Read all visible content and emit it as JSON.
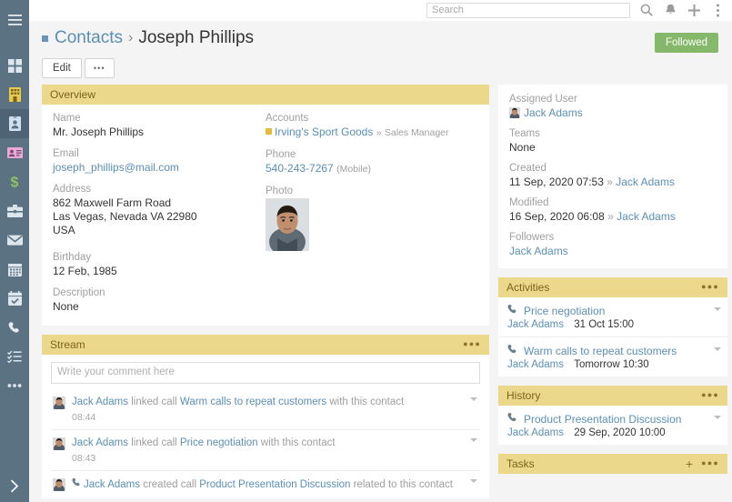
{
  "sidebar": {
    "menu_icon": "hamburger-icon",
    "collapse_icon": "chevron-right-icon",
    "items": [
      {
        "name": "dashboard",
        "icon": "grid-icon"
      },
      {
        "name": "accounts",
        "icon": "building-icon"
      },
      {
        "name": "contacts",
        "icon": "id-badge-icon",
        "active": true
      },
      {
        "name": "leads",
        "icon": "contact-card-icon"
      },
      {
        "name": "opportunities",
        "icon": "dollar-icon"
      },
      {
        "name": "cases",
        "icon": "briefcase-icon"
      },
      {
        "name": "emails",
        "icon": "envelope-icon"
      },
      {
        "name": "calendar",
        "icon": "calendar-icon"
      },
      {
        "name": "meetings",
        "icon": "calendar-check-icon"
      },
      {
        "name": "calls",
        "icon": "phone-icon"
      },
      {
        "name": "tasks",
        "icon": "list-check-icon"
      },
      {
        "name": "more",
        "icon": "ellipsis-icon"
      }
    ]
  },
  "topbar": {
    "search_placeholder": "Search",
    "search_value": "",
    "search_icon": "magnifier-icon",
    "bell_icon": "bell-icon",
    "plus_icon": "plus-icon",
    "menu_icon": "vertical-ellipsis-icon"
  },
  "header": {
    "breadcrumb_link": "Contacts",
    "breadcrumb_separator": "›",
    "breadcrumb_current": "Joseph Phillips",
    "follow_label": "Followed",
    "follow_color": "#85b86a",
    "edit_label": "Edit",
    "more_label": "•••"
  },
  "overview": {
    "title": "Overview",
    "name_label": "Name",
    "name_value": "Mr. Joseph Phillips",
    "email_label": "Email",
    "email_value": "joseph_phillips@mail.com",
    "address_label": "Address",
    "address_line1": "862 Maxwell Farm Road",
    "address_line2": "Las Vegas, Nevada VA 22980",
    "address_line3": "USA",
    "birthday_label": "Birthday",
    "birthday_value": "12 Feb, 1985",
    "description_label": "Description",
    "description_value": "None",
    "accounts_label": "Accounts",
    "accounts_value": "Irving's Sport Goods",
    "accounts_role_sep": "»",
    "accounts_role": "Sales Manager",
    "accounts_marker_color": "#e8bb3c",
    "phone_label": "Phone",
    "phone_value": "540-243-7267",
    "phone_type": "(Mobile)",
    "photo_label": "Photo"
  },
  "stream": {
    "title": "Stream",
    "comment_placeholder": "Write your comment here",
    "comment_value": "",
    "items": [
      {
        "actor": "Jack Adams",
        "action": "linked call",
        "subject": "Warm calls to repeat customers",
        "suffix": "with this contact",
        "time": "08:44",
        "icon": ""
      },
      {
        "actor": "Jack Adams",
        "action": "linked call",
        "subject": "Price negotiation",
        "suffix": "with this contact",
        "time": "08:43",
        "icon": ""
      },
      {
        "actor": "Jack Adams",
        "action": "created call",
        "subject": "Product Presentation Discussion",
        "suffix": "related to this contact",
        "time": "",
        "icon": "phone-icon"
      }
    ]
  },
  "side": {
    "assigned_user_label": "Assigned User",
    "assigned_user_value": "Jack Adams",
    "teams_label": "Teams",
    "teams_value": "None",
    "created_label": "Created",
    "created_value": "11 Sep, 2020 07:53",
    "created_sep": "»",
    "created_by": "Jack Adams",
    "modified_label": "Modified",
    "modified_value": "16 Sep, 2020 06:08",
    "modified_sep": "»",
    "modified_by": "Jack Adams",
    "followers_label": "Followers",
    "followers_value": "Jack Adams"
  },
  "activities": {
    "title": "Activities",
    "rows": [
      {
        "icon": "phone-icon",
        "name": "Price negotiation",
        "user": "Jack Adams",
        "when": "31 Oct 15:00"
      },
      {
        "icon": "phone-icon",
        "name": "Warm calls to repeat customers",
        "user": "Jack Adams",
        "when": "Tomorrow 10:30"
      }
    ]
  },
  "history": {
    "title": "History",
    "rows": [
      {
        "icon": "phone-icon",
        "name": "Product Presentation Discussion",
        "user": "Jack Adams",
        "when": "29 Sep, 2020 10:00"
      }
    ]
  },
  "tasks": {
    "title": "Tasks",
    "add_label": "+"
  },
  "theme": {
    "panel_header_bg": "#ecd88a",
    "panel_header_text": "#7a6420",
    "sidebar_bg": "#5b7283",
    "link": "#5b8fb5",
    "page_bg": "#f4f4f4"
  }
}
